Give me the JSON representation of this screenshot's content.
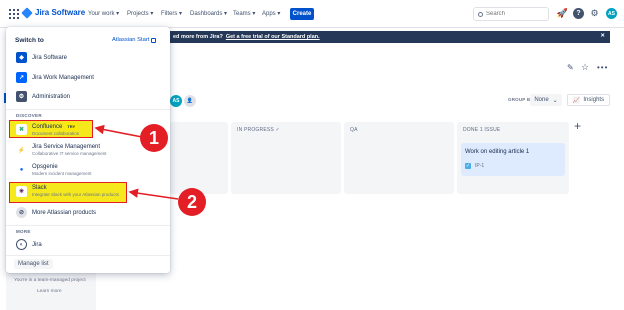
{
  "topnav": {
    "brand": "Jira Software",
    "items": [
      "Your work",
      "Projects",
      "Filters",
      "Dashboards",
      "Teams",
      "Apps"
    ],
    "create_label": "Create",
    "search_placeholder": "Search"
  },
  "banner": {
    "text": "ed more from Jira?",
    "link": "Get a free trial of our Standard plan."
  },
  "board": {
    "group_by_label": "GROUP BY",
    "group_by_value": "None",
    "insights_label": "Insights",
    "avatar_initials": "AS",
    "columns": [
      {
        "title": "IN PROGRESS"
      },
      {
        "title": "QA"
      },
      {
        "title": "DONE 1 ISSUE"
      }
    ],
    "done_card": {
      "title": "Work on editing article 1",
      "key": "IP-1"
    }
  },
  "sidebar": {
    "team_managed": "You're in a team-managed project",
    "learn_more": "Learn more"
  },
  "switcher": {
    "title": "Switch to",
    "atlassian_start": "Atlassian Start",
    "apps": [
      {
        "label": "Jira Software"
      },
      {
        "label": "Jira Work Management"
      },
      {
        "label": "Administration"
      }
    ],
    "discover_label": "DISCOVER",
    "discover": [
      {
        "label": "Confluence",
        "badge": "TRY",
        "sub": "Document collaboration"
      },
      {
        "label": "Jira Service Management",
        "sub": "Collaborative IT service management"
      },
      {
        "label": "Opsgenie",
        "sub": "Modern incident management"
      },
      {
        "label": "Slack",
        "sub": "Integrate Slack with your Atlassian products"
      },
      {
        "label": "More Atlassian products"
      }
    ],
    "more_label": "MORE",
    "more": [
      {
        "label": "Jira"
      }
    ],
    "manage_list": "Manage list"
  },
  "callouts": [
    "1",
    "2"
  ],
  "colors": {
    "highlight": "#f5e81d",
    "callout": "#e31e24",
    "brand": "#0052cc"
  }
}
